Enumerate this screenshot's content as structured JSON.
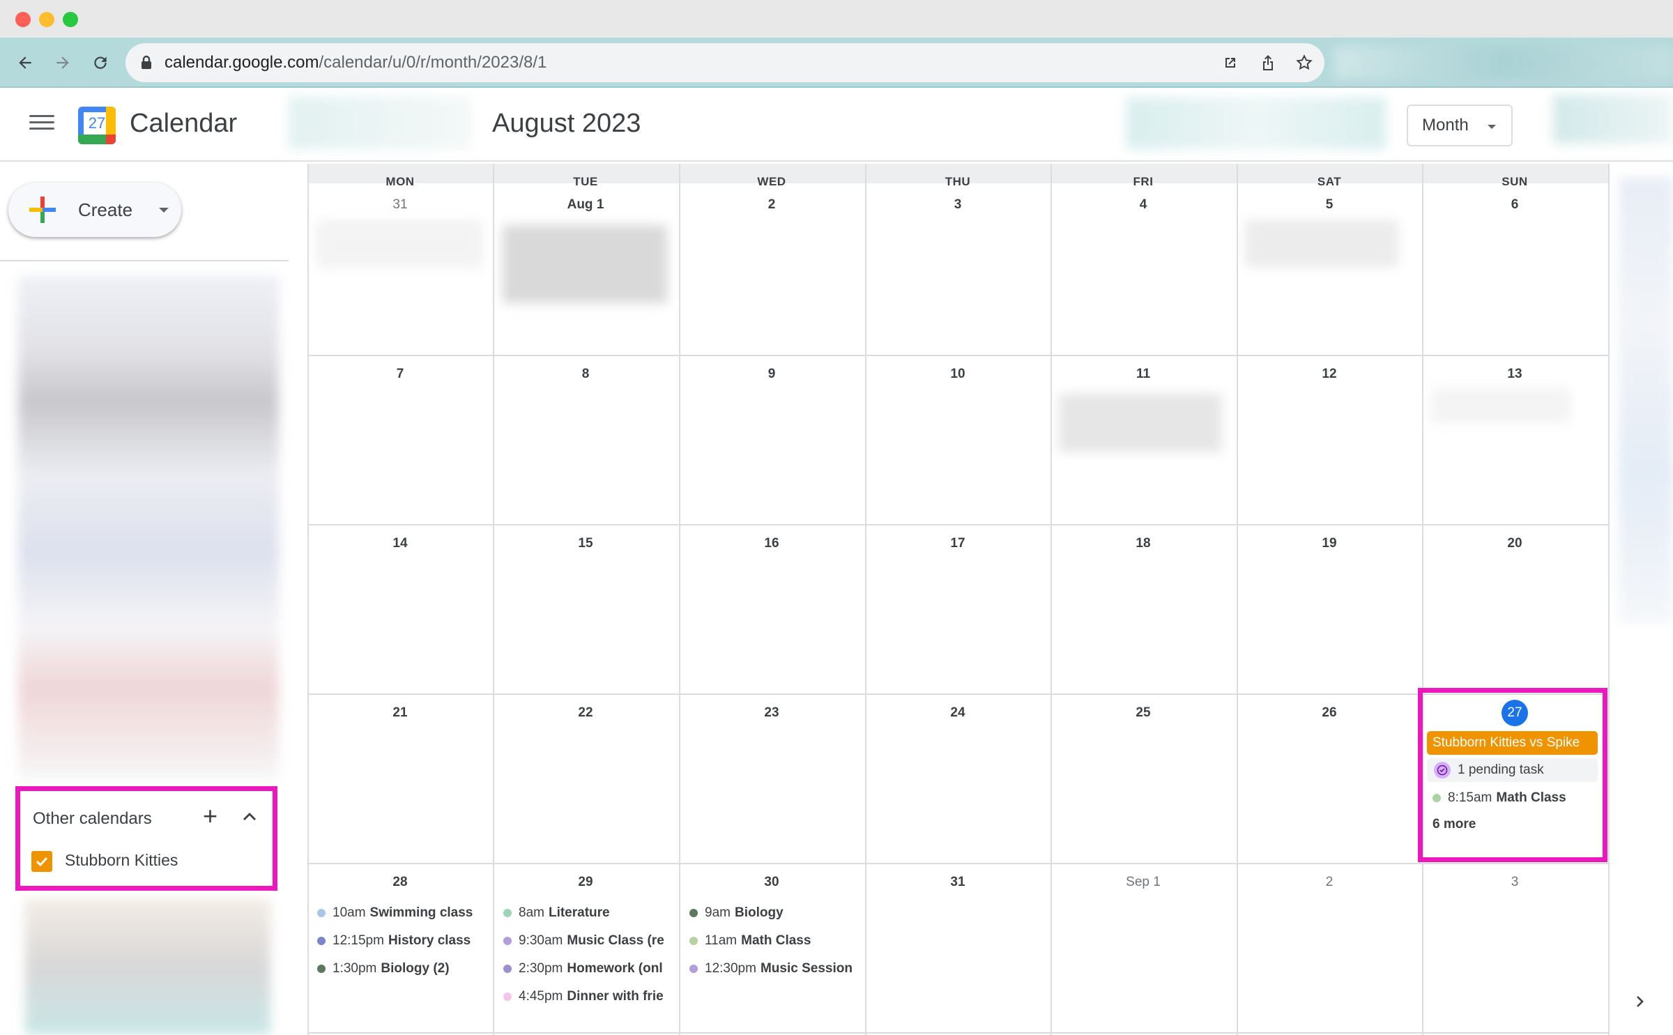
{
  "browser": {
    "url_domain": "calendar.google.com",
    "url_path": "/calendar/u/0/r/month/2023/8/1"
  },
  "app": {
    "title": "Calendar",
    "logo_day": "27",
    "month_title": "August 2023",
    "view_label": "Month"
  },
  "sidebar": {
    "create_label": "Create",
    "other_calendars": {
      "title": "Other calendars",
      "add_symbol": "+",
      "items": [
        {
          "name": "Stubborn Kitties",
          "color": "#f09300",
          "checked": true
        }
      ]
    }
  },
  "weekdays": [
    "MON",
    "TUE",
    "WED",
    "THU",
    "FRI",
    "SAT",
    "SUN"
  ],
  "weeks": [
    [
      "31",
      "Aug 1",
      "2",
      "3",
      "4",
      "5",
      "6"
    ],
    [
      "7",
      "8",
      "9",
      "10",
      "11",
      "12",
      "13"
    ],
    [
      "14",
      "15",
      "16",
      "17",
      "18",
      "19",
      "20"
    ],
    [
      "21",
      "22",
      "23",
      "24",
      "25",
      "26",
      "27"
    ],
    [
      "28",
      "29",
      "30",
      "31",
      "Sep 1",
      "2",
      "3"
    ]
  ],
  "today": {
    "date": "27",
    "all_day_event": "Stubborn Kitties vs Spike",
    "task": "1 pending task",
    "event": {
      "time": "8:15am",
      "name": "Math Class",
      "color": "#a8d5a2"
    },
    "more": "6 more"
  },
  "events": {
    "mon28": [
      {
        "time": "10am",
        "name": "Swimming class",
        "color": "#a7c7e7"
      },
      {
        "time": "12:15pm",
        "name": "History class",
        "color": "#7986cb"
      },
      {
        "time": "1:30pm",
        "name": "Biology (2)",
        "color": "#5b7a5b"
      }
    ],
    "tue29": [
      {
        "time": "8am",
        "name": "Literature",
        "color": "#9fd3b5"
      },
      {
        "time": "9:30am",
        "name": "Music Class (re",
        "color": "#b39ddb"
      },
      {
        "time": "2:30pm",
        "name": "Homework (onl",
        "color": "#9e8fd0"
      },
      {
        "time": "4:45pm",
        "name": "Dinner with frie",
        "color": "#f3c6e8"
      }
    ],
    "wed30": [
      {
        "time": "9am",
        "name": "Biology",
        "color": "#5b7a5b"
      },
      {
        "time": "11am",
        "name": "Math Class",
        "color": "#b5d3a0"
      },
      {
        "time": "12:30pm",
        "name": "Music Session",
        "color": "#b39ddb"
      }
    ]
  }
}
